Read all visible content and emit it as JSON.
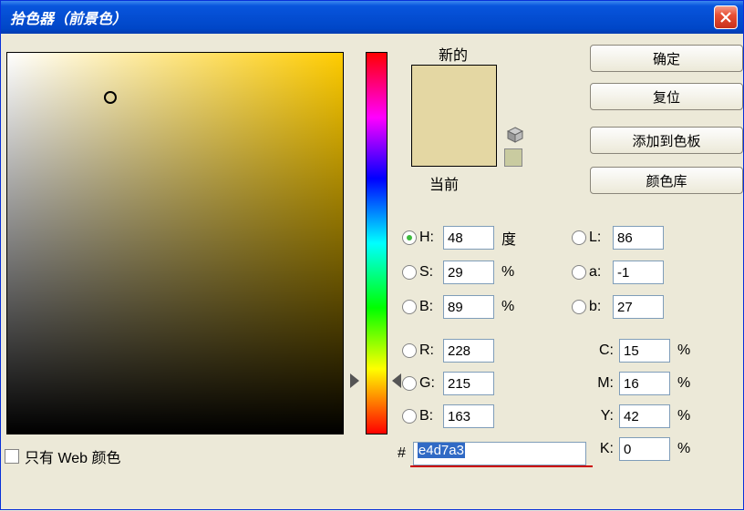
{
  "title": "拾色器（前景色）",
  "buttons": {
    "ok": "确定",
    "reset": "复位",
    "add": "添加到色板",
    "lib": "颜色库"
  },
  "labels": {
    "new": "新的",
    "current": "当前",
    "webonly": "只有 Web 颜色",
    "hex": "#",
    "deg": "度",
    "pct": "%"
  },
  "hsb": {
    "h": "48",
    "s": "29",
    "b": "89"
  },
  "rgb": {
    "r": "228",
    "g": "215",
    "b": "163"
  },
  "lab": {
    "l": "86",
    "a": "-1",
    "b": "27"
  },
  "cmyk": {
    "c": "15",
    "m": "16",
    "y": "42",
    "k": "0"
  },
  "hex": "e4d7a3",
  "ch": {
    "H": "H:",
    "S": "S:",
    "B": "B:",
    "R": "R:",
    "G": "G:",
    "Bb": "B:",
    "L": "L:",
    "a": "a:",
    "b": "b:",
    "C": "C:",
    "M": "M:",
    "Y": "Y:",
    "K": "K:"
  }
}
